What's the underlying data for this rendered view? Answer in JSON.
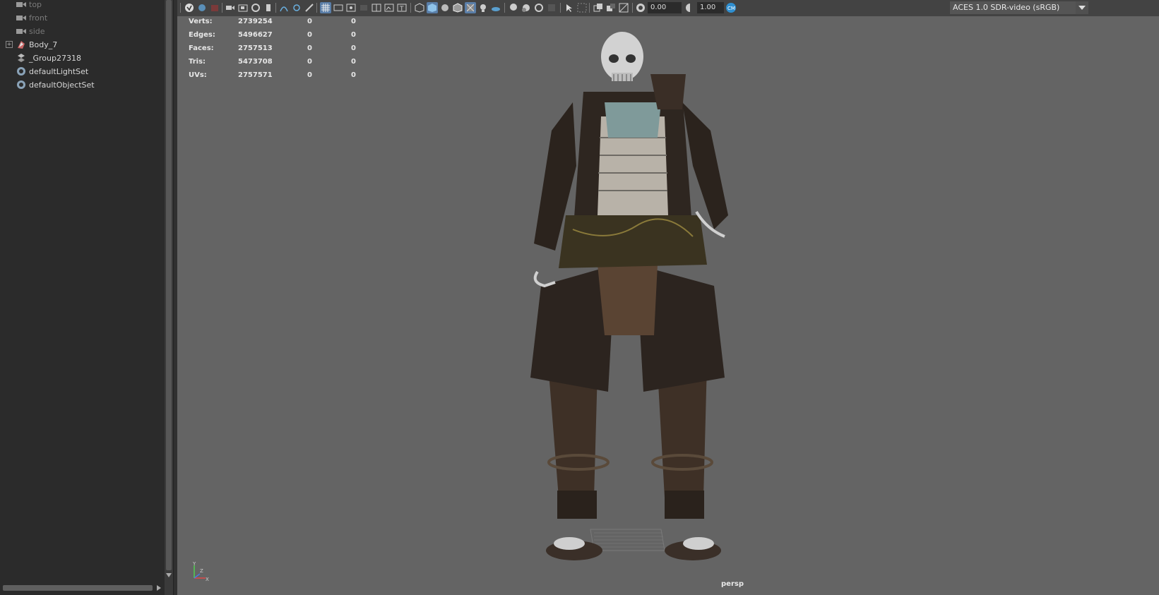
{
  "outliner": {
    "items": [
      {
        "label": "top",
        "icon": "camera-icon",
        "dim": true
      },
      {
        "label": "front",
        "icon": "camera-icon",
        "dim": true
      },
      {
        "label": "side",
        "icon": "camera-icon",
        "dim": true
      },
      {
        "label": "Body_7",
        "icon": "mesh-group-icon",
        "dim": false,
        "expandable": true
      },
      {
        "label": "_Group27318",
        "icon": "group-icon",
        "dim": false
      },
      {
        "label": "defaultLightSet",
        "icon": "set-icon",
        "dim": false
      },
      {
        "label": "defaultObjectSet",
        "icon": "set-icon",
        "dim": false
      }
    ]
  },
  "toolbar": {
    "exposure_value": "0.00",
    "gamma_value": "1.00",
    "color_space": "ACES 1.0 SDR-video (sRGB)",
    "accent": "#5a7ea8"
  },
  "hud": {
    "rows": [
      {
        "label": "Verts:",
        "total": "2739254",
        "a": "0",
        "b": "0"
      },
      {
        "label": "Edges:",
        "total": "5496627",
        "a": "0",
        "b": "0"
      },
      {
        "label": "Faces:",
        "total": "2757513",
        "a": "0",
        "b": "0"
      },
      {
        "label": "Tris:",
        "total": "5473708",
        "a": "0",
        "b": "0"
      },
      {
        "label": "UVs:",
        "total": "2757571",
        "a": "0",
        "b": "0"
      }
    ]
  },
  "viewport": {
    "camera_label": "persp",
    "axis": {
      "y": "Y",
      "x": "X",
      "z": "Z"
    }
  }
}
